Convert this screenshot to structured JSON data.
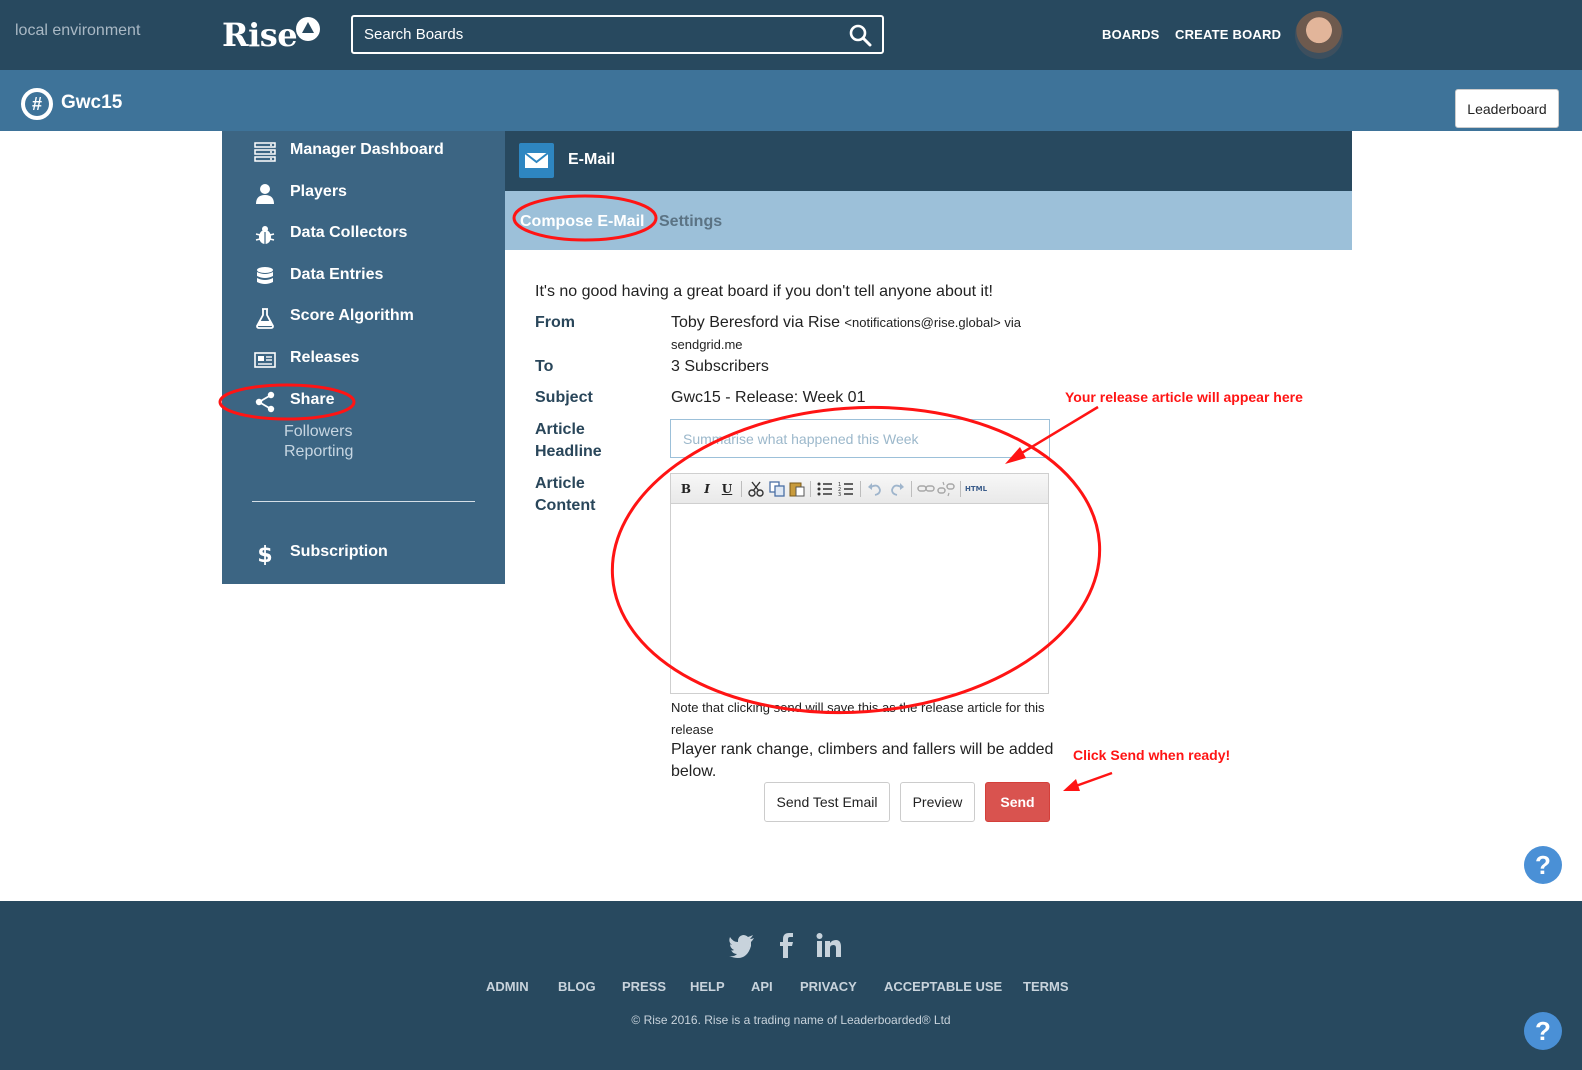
{
  "header": {
    "environment": "local environment",
    "logo": "Rise",
    "search_placeholder": "Search Boards",
    "nav": [
      "BOARDS",
      "CREATE BOARD"
    ]
  },
  "board": {
    "title": "Gwc15",
    "leaderboard_button": "Leaderboard"
  },
  "sidebar": {
    "items": [
      {
        "label": "Manager Dashboard",
        "icon": "server-icon"
      },
      {
        "label": "Players",
        "icon": "user-icon"
      },
      {
        "label": "Data Collectors",
        "icon": "bug-icon"
      },
      {
        "label": "Data Entries",
        "icon": "database-icon"
      },
      {
        "label": "Score Algorithm",
        "icon": "flask-icon"
      },
      {
        "label": "Releases",
        "icon": "newspaper-icon"
      },
      {
        "label": "Share",
        "icon": "share-icon"
      }
    ],
    "share_sub": [
      "Followers",
      "Reporting"
    ],
    "subscription": {
      "label": "Subscription",
      "icon": "dollar-icon"
    }
  },
  "panel": {
    "title": "E-Mail",
    "tabs": [
      "Compose E-Mail",
      "Settings"
    ]
  },
  "compose": {
    "intro": "It's no good having a great board if you don't tell anyone about it!",
    "from_label": "From",
    "from_name": "Toby Beresford via Rise",
    "from_address": "<notifications@rise.global> via sendgrid.me",
    "to_label": "To",
    "to_value": "3 Subscribers",
    "subject_label": "Subject",
    "subject_value": "Gwc15 - Release: Week 01",
    "headline_label_1": "Article",
    "headline_label_2": "Headline",
    "headline_placeholder": "Summarise what happened this Week",
    "content_label_1": "Article",
    "content_label_2": "Content",
    "toolbar": [
      "B",
      "I",
      "U",
      "cut",
      "copy",
      "paste",
      "bullet-list",
      "numbered-list",
      "undo",
      "redo",
      "link",
      "unlink",
      "HTML"
    ],
    "note": "Note that clicking send will save this as the release article for this release",
    "note2": "Player rank change, climbers and fallers will be added below.",
    "buttons": {
      "test": "Send Test Email",
      "preview": "Preview",
      "send": "Send"
    }
  },
  "annotations": {
    "article_hint": "Your release article will appear here",
    "send_hint": "Click Send when ready!"
  },
  "help": "?",
  "footer": {
    "social": [
      "twitter-icon",
      "facebook-icon",
      "linkedin-icon"
    ],
    "links": [
      "ADMIN",
      "BLOG",
      "PRESS",
      "HELP",
      "API",
      "PRIVACY",
      "ACCEPTABLE USE",
      "TERMS"
    ],
    "copyright": "© Rise 2016. Rise is a trading name of Leaderboarded® Ltd"
  },
  "colors": {
    "header_bg": "#28495f",
    "board_bar": "#3e7399",
    "sidebar_bg": "#3c6583",
    "tabs_bg": "#9cc0d9",
    "send_button": "#d9534f",
    "annotation_red": "#ff1414"
  }
}
